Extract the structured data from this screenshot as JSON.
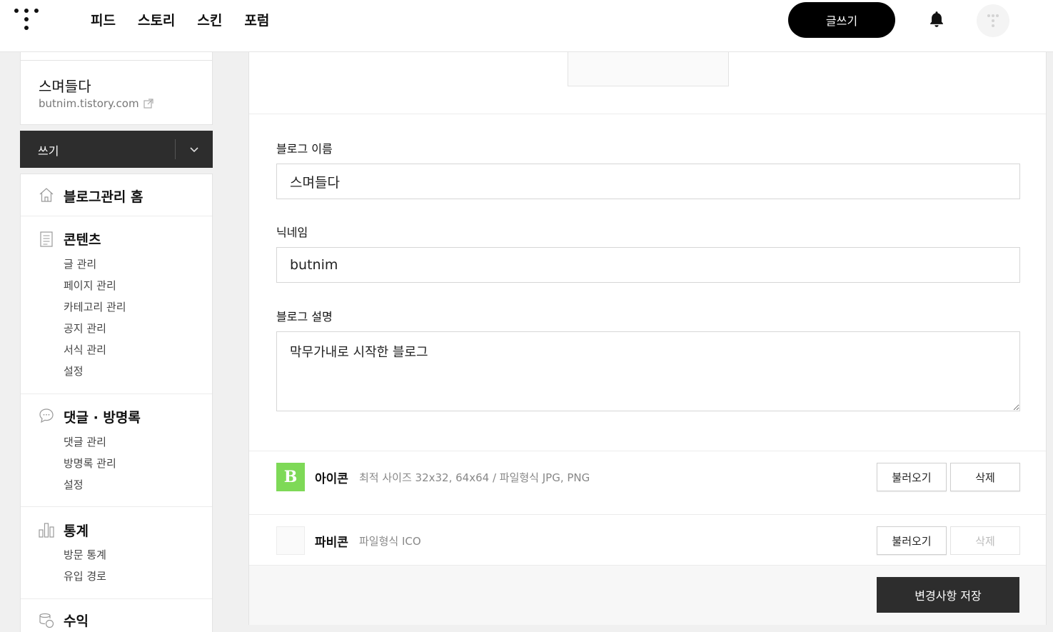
{
  "nav": {
    "items": [
      "피드",
      "스토리",
      "스킨",
      "포럼"
    ],
    "write_label": "글쓰기"
  },
  "sidebar": {
    "blog_name": "스며들다",
    "blog_url": "butnim.tistory.com",
    "write_label": "쓰기",
    "home_label": "블로그관리 홈",
    "sections": [
      {
        "title": "콘텐츠",
        "icon": "document-icon",
        "items": [
          "글 관리",
          "페이지 관리",
          "카테고리 관리",
          "공지 관리",
          "서식 관리",
          "설정"
        ]
      },
      {
        "title": "댓글 · 방명록",
        "icon": "comment-icon",
        "items": [
          "댓글 관리",
          "방명록 관리",
          "설정"
        ]
      },
      {
        "title": "통계",
        "icon": "bar-chart-icon",
        "items": [
          "방문 통계",
          "유입 경로"
        ]
      },
      {
        "title": "수익",
        "icon": "coins-icon",
        "items": []
      }
    ]
  },
  "form": {
    "blog_name_label": "블로그 이름",
    "blog_name_value": "스며들다",
    "nickname_label": "닉네임",
    "nickname_value": "butnim",
    "description_label": "블로그 설명",
    "description_value": "막무가내로 시작한 블로그",
    "icon": {
      "title": "아이콘",
      "hint": "최적 사이즈 32x32, 64x64 / 파일형식 JPG, PNG",
      "load_label": "불러오기",
      "delete_label": "삭제",
      "thumb_letter": "B",
      "thumb_color": "#7ed957"
    },
    "favicon": {
      "title": "파비콘",
      "hint": "파일형식 ICO",
      "load_label": "불러오기",
      "delete_label": "삭제"
    },
    "save_label": "변경사항 저장"
  }
}
